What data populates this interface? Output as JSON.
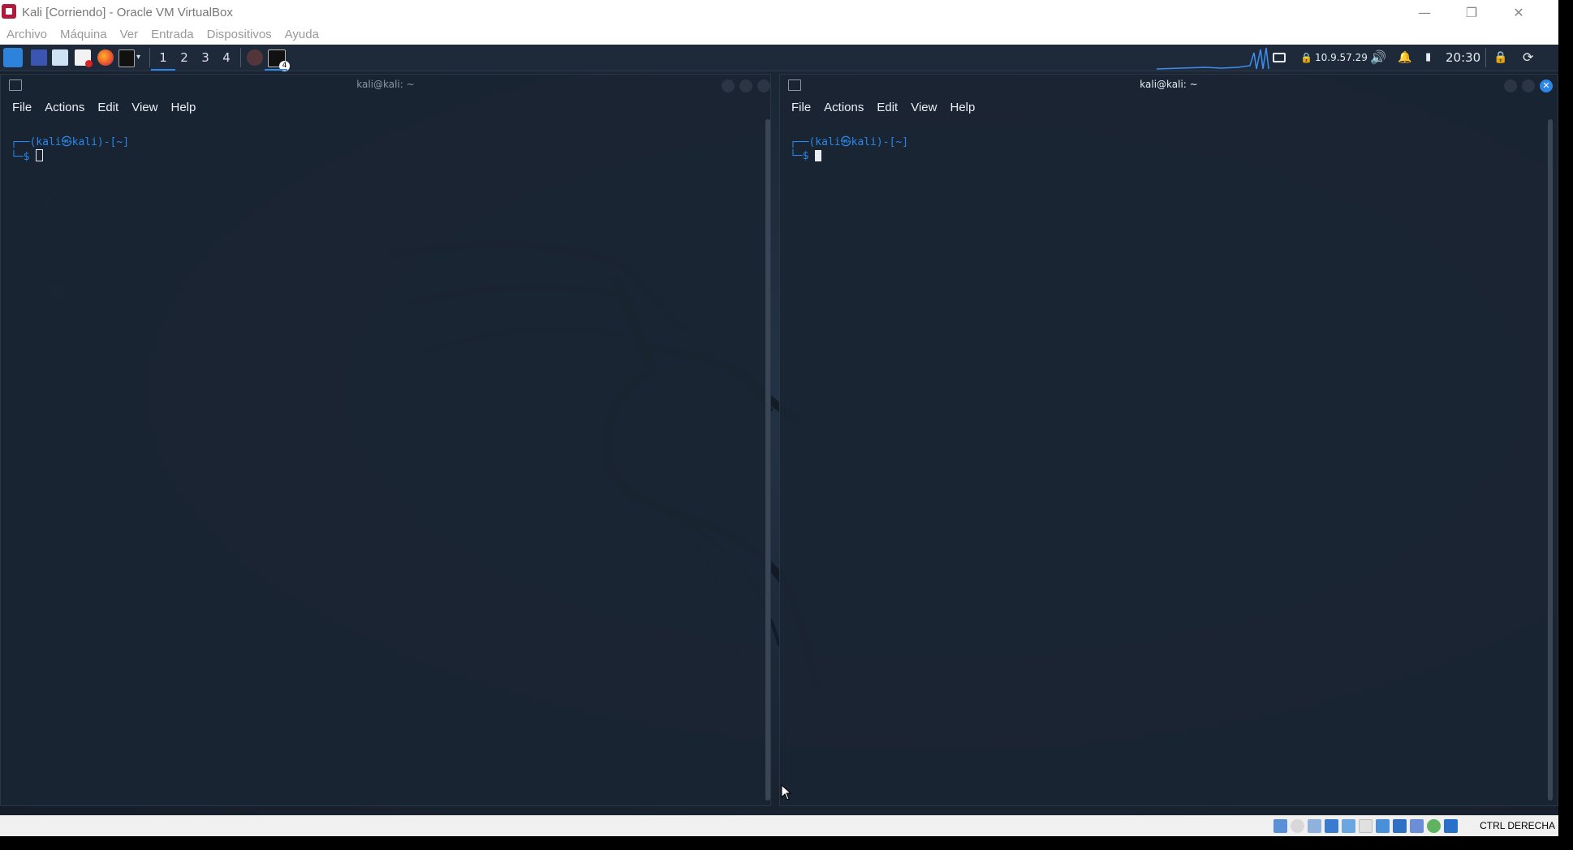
{
  "window": {
    "title": "Kali [Corriendo] - Oracle VM VirtualBox",
    "controls": {
      "minimize": "—",
      "restore": "❐",
      "close": "✕"
    }
  },
  "host_menu": [
    "Archivo",
    "Máquina",
    "Ver",
    "Entrada",
    "Dispositivos",
    "Ayuda"
  ],
  "panel": {
    "workspaces": [
      "1",
      "2",
      "3",
      "4"
    ],
    "window_badge": "4",
    "ip": "10.9.57.29",
    "clock": "20:30"
  },
  "terminals": [
    {
      "title": "kali@kali: ~",
      "menu": [
        "File",
        "Actions",
        "Edit",
        "View",
        "Help"
      ],
      "prompt_top": "┌──(kali㉿kali)-[~]",
      "prompt_bottom": "└─$"
    },
    {
      "title": "kali@kali: ~",
      "menu": [
        "File",
        "Actions",
        "Edit",
        "View",
        "Help"
      ],
      "prompt_top": "┌──(kali㉿kali)-[~]",
      "prompt_bottom": "└─$"
    }
  ],
  "statusbar": {
    "host_key": "CTRL DERECHA"
  },
  "colors": {
    "accent": "#2b86e8",
    "terminal_bg": "#1a2533",
    "panel_bg": "#1e2a3a"
  }
}
